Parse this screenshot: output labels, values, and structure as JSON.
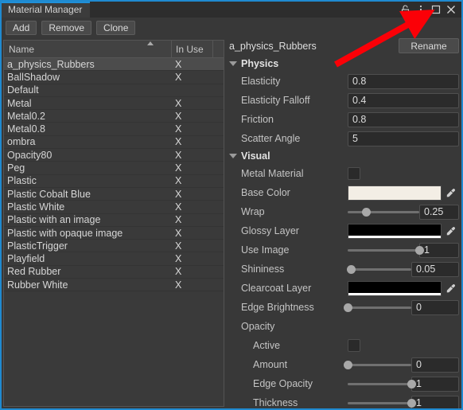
{
  "window": {
    "tab_label": "Material Manager",
    "controls": [
      {
        "name": "lock-icon",
        "label": "Lock"
      },
      {
        "name": "more-menu-icon",
        "label": "More"
      },
      {
        "name": "maximize-icon",
        "label": "Maximize"
      },
      {
        "name": "close-icon",
        "label": "Close"
      }
    ],
    "accent_color": "#2090d8",
    "border_color": "#1f8ad0",
    "background_color": "#383838"
  },
  "toolbar": {
    "add_label": "Add",
    "remove_label": "Remove",
    "clone_label": "Clone"
  },
  "list": {
    "columns": [
      "Name",
      "In Use"
    ],
    "sort_column": "Name",
    "sort_direction": "ascending",
    "selected": "a_physics_Rubbers",
    "rows": [
      {
        "name": "a_physics_Rubbers",
        "in_use": "X",
        "selected": true
      },
      {
        "name": "BallShadow",
        "in_use": "X",
        "selected": false
      },
      {
        "name": "Default",
        "in_use": "",
        "selected": false
      },
      {
        "name": "Metal",
        "in_use": "X",
        "selected": false
      },
      {
        "name": "Metal0.2",
        "in_use": "X",
        "selected": false
      },
      {
        "name": "Metal0.8",
        "in_use": "X",
        "selected": false
      },
      {
        "name": "ombra",
        "in_use": "X",
        "selected": false
      },
      {
        "name": "Opacity80",
        "in_use": "X",
        "selected": false
      },
      {
        "name": "Peg",
        "in_use": "X",
        "selected": false
      },
      {
        "name": "Plastic",
        "in_use": "X",
        "selected": false
      },
      {
        "name": "Plastic Cobalt Blue",
        "in_use": "X",
        "selected": false
      },
      {
        "name": "Plastic White",
        "in_use": "X",
        "selected": false
      },
      {
        "name": "Plastic with an image",
        "in_use": "X",
        "selected": false
      },
      {
        "name": "Plastic with opaque image",
        "in_use": "X",
        "selected": false
      },
      {
        "name": "PlasticTrigger",
        "in_use": "X",
        "selected": false
      },
      {
        "name": "Playfield",
        "in_use": "X",
        "selected": false
      },
      {
        "name": "Red Rubber",
        "in_use": "X",
        "selected": false
      },
      {
        "name": "Rubber White",
        "in_use": "X",
        "selected": false
      }
    ]
  },
  "properties": {
    "material_name": "a_physics_Rubbers",
    "rename_label": "Rename",
    "physics": {
      "title": "Physics",
      "expanded": true,
      "elasticity_label": "Elasticity",
      "elasticity_value": "0.8",
      "elasticity_falloff_label": "Elasticity Falloff",
      "elasticity_falloff_value": "0.4",
      "friction_label": "Friction",
      "friction_value": "0.8",
      "scatter_angle_label": "Scatter Angle",
      "scatter_angle_value": "5"
    },
    "visual": {
      "title": "Visual",
      "expanded": true,
      "metal_material_label": "Metal Material",
      "metal_material_checked": false,
      "base_color_label": "Base Color",
      "base_color_value": "#f3eee5",
      "base_color_alpha": "#f3eee5",
      "wrap_label": "Wrap",
      "wrap_value": "0.25",
      "wrap_percent": 25,
      "glossy_layer_label": "Glossy Layer",
      "glossy_layer_value": "#000000",
      "glossy_layer_alpha": "#ffffff",
      "use_image_label": "Use Image",
      "use_image_value": "1",
      "use_image_percent": 100,
      "shininess_label": "Shininess",
      "shininess_value": "0.05",
      "shininess_percent": 5,
      "clearcoat_layer_label": "Clearcoat Layer",
      "clearcoat_layer_value": "#000000",
      "clearcoat_layer_alpha": "#ffffff",
      "edge_brightness_label": "Edge Brightness",
      "edge_brightness_value": "0",
      "edge_brightness_percent": 0,
      "opacity": {
        "title": "Opacity",
        "active_label": "Active",
        "active_checked": false,
        "amount_label": "Amount",
        "amount_value": "0",
        "amount_percent": 0,
        "edge_opacity_label": "Edge Opacity",
        "edge_opacity_value": "1",
        "edge_opacity_percent": 100,
        "thickness_label": "Thickness",
        "thickness_value": "1",
        "thickness_percent": 100
      }
    }
  },
  "annotation": {
    "arrow_color": "#fb0007",
    "name": "red-pointer-arrow"
  }
}
